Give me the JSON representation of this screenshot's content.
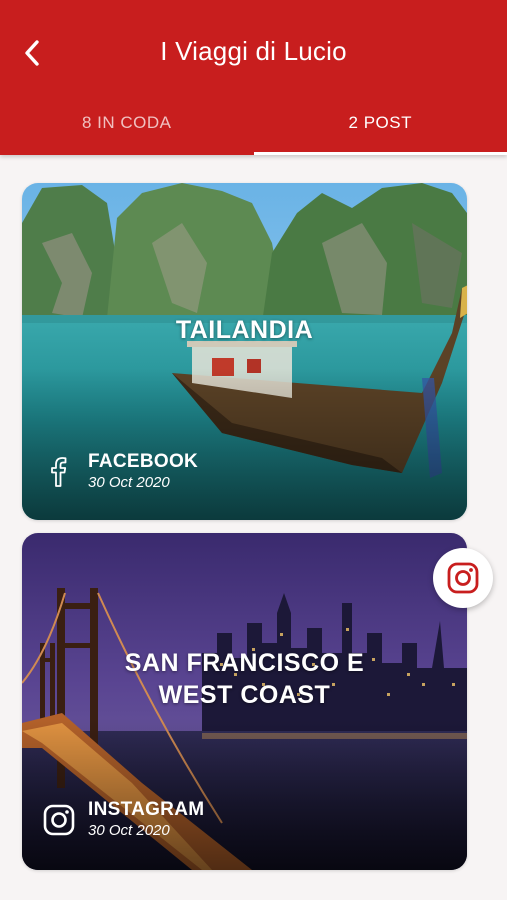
{
  "header": {
    "title": "I Viaggi di Lucio",
    "back_icon": "back-chevron-icon",
    "background": "#c81e1e",
    "tabs": [
      {
        "label": "8 IN CODA",
        "active": false
      },
      {
        "label": "2 POST",
        "active": true
      }
    ]
  },
  "posts": [
    {
      "title": "TAILANDIA",
      "network": "FACEBOOK",
      "network_icon": "facebook-icon",
      "date": "30 Oct 2020"
    },
    {
      "title": "SAN FRANCISCO E WEST COAST",
      "network": "INSTAGRAM",
      "network_icon": "instagram-icon",
      "date": "30 Oct 2020"
    }
  ],
  "fab": {
    "icon": "instagram-icon",
    "color": "#c81e1e"
  }
}
